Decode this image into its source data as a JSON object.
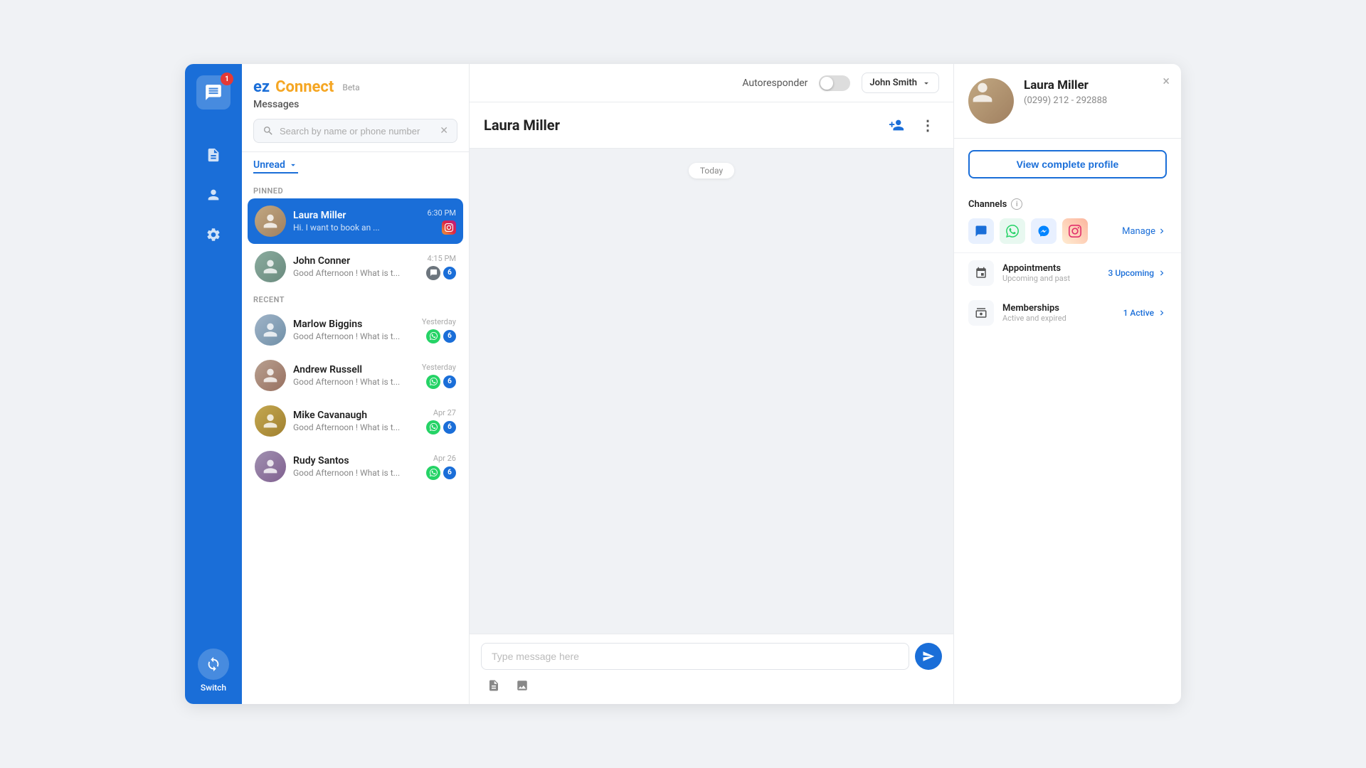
{
  "app": {
    "title_ez": "ez",
    "title_connect": "Connect",
    "title_beta": "Beta",
    "messages_label": "Messages",
    "autoresponder_label": "Autoresponder",
    "user_name": "John Smith"
  },
  "search": {
    "placeholder": "Search by name or phone number"
  },
  "filter": {
    "label": "Unread"
  },
  "sections": {
    "pinned": "PINNED",
    "recent": "RECENT"
  },
  "contacts": [
    {
      "id": "laura",
      "name": "Laura Miller",
      "preview": "Hi. I want to book an ...",
      "time": "6:30 PM",
      "section": "pinned",
      "active": true,
      "channel": "instagram",
      "unread": null
    },
    {
      "id": "john",
      "name": "John Conner",
      "preview": "Good Afternoon ! What is t...",
      "time": "4:15 PM",
      "section": "pinned",
      "active": false,
      "channel": "sms",
      "unread": "6"
    },
    {
      "id": "marlow",
      "name": "Marlow Biggins",
      "preview": "Good Afternoon ! What is t...",
      "time": "Yesterday",
      "section": "recent",
      "active": false,
      "channel": "whatsapp",
      "unread": "6"
    },
    {
      "id": "andrew",
      "name": "Andrew Russell",
      "preview": "Good Afternoon ! What is t...",
      "time": "Yesterday",
      "section": "recent",
      "active": false,
      "channel": "whatsapp",
      "unread": "6"
    },
    {
      "id": "mike",
      "name": "Mike Cavanaugh",
      "preview": "Good Afternoon ! What is t...",
      "time": "Apr 27",
      "section": "recent",
      "active": false,
      "channel": "whatsapp",
      "unread": "6"
    },
    {
      "id": "rudy",
      "name": "Rudy Santos",
      "preview": "Good Afternoon ! What is t...",
      "time": "Apr 26",
      "section": "recent",
      "active": false,
      "channel": "whatsapp",
      "unread": "6"
    }
  ],
  "chat": {
    "active_name": "Laura Miller",
    "date_badge": "Today",
    "message_placeholder": "Type message here",
    "send_label": "Send"
  },
  "profile": {
    "name": "Laura Miller",
    "phone": "(0299) 212 - 292888",
    "view_profile_label": "View complete profile",
    "close_label": "×",
    "channels_title": "Channels",
    "manage_label": "Manage",
    "appointments_title": "Appointments",
    "appointments_sub": "Upcoming and past",
    "appointments_badge": "3 Upcoming",
    "memberships_title": "Memberships",
    "memberships_sub": "Active and expired",
    "memberships_badge": "1 Active"
  },
  "nav": {
    "badge": "1",
    "switch_label": "Switch"
  }
}
